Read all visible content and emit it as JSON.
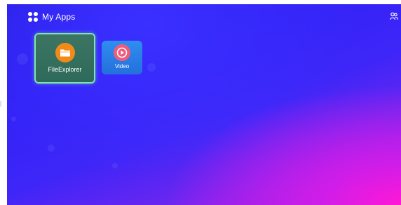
{
  "header": {
    "title": "My Apps",
    "apps_icon": "apps-icon",
    "user_icon": "user-icon"
  },
  "apps": [
    {
      "label": "FileExplorer",
      "icon": "folder-icon",
      "icon_color": "#f28a1a",
      "tile_color": "#3d7563",
      "selected": true
    },
    {
      "label": "Video",
      "icon": "play-icon",
      "icon_color": "#ee5c7c",
      "tile_color": "#2f8ef0",
      "selected": false
    }
  ],
  "colors": {
    "background_primary": "#3222f6",
    "background_accent": "#ff18d6",
    "focus_border": "#7ee6a8"
  }
}
